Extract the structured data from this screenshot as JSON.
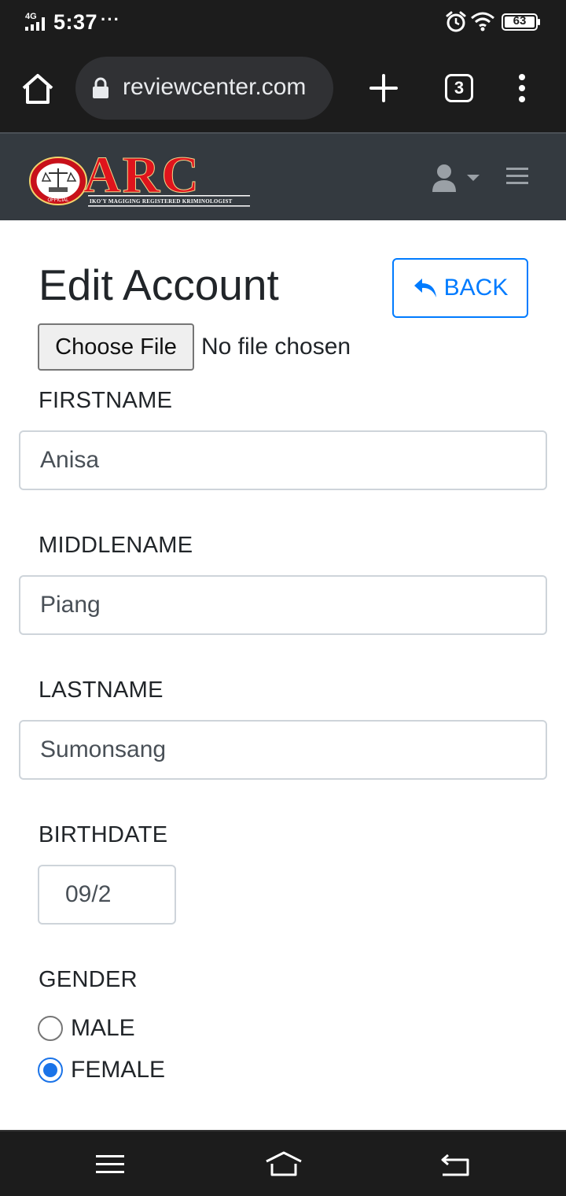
{
  "status_bar": {
    "network": "4G",
    "time": "5:37",
    "overflow": "···",
    "battery_level": "63",
    "icons": [
      "signal-icon",
      "alarm-icon",
      "wifi-icon",
      "battery-icon"
    ]
  },
  "browser": {
    "url": "reviewcenter.com",
    "tab_count": "3",
    "icons": [
      "home-icon",
      "lock-icon",
      "new-tab-plus-icon",
      "overflow-menu-icon"
    ]
  },
  "site_nav": {
    "logo_text": "ARC",
    "logo_tagline": "IKO'Y MAGIGING REGISTERED KRIMINOLOGIST",
    "logo_seal_text": "OFFICIAL",
    "brand_color": "#e0141c",
    "background": "#343a40",
    "icons": [
      "user-icon",
      "caret-down-icon",
      "hamburger-icon"
    ]
  },
  "form": {
    "title": "Edit Account",
    "back_label": "BACK",
    "back_icon": "reply-arrow-icon",
    "accent": "#007bff",
    "file": {
      "button_label": "Choose File",
      "status": "No file chosen"
    },
    "firstname": {
      "label": "FIRSTNAME",
      "value": "Anisa"
    },
    "middlename": {
      "label": "MIDDLENAME",
      "value": "Piang"
    },
    "lastname": {
      "label": "LASTNAME",
      "value": "Sumonsang"
    },
    "birthdate": {
      "label": "BIRTHDATE",
      "value": "09/2"
    },
    "gender": {
      "label": "GENDER",
      "options": [
        {
          "label": "MALE",
          "checked": false
        },
        {
          "label": "FEMALE",
          "checked": true
        }
      ]
    }
  },
  "android_nav": {
    "icons": [
      "recents-menu-icon",
      "home-icon",
      "back-icon"
    ]
  }
}
